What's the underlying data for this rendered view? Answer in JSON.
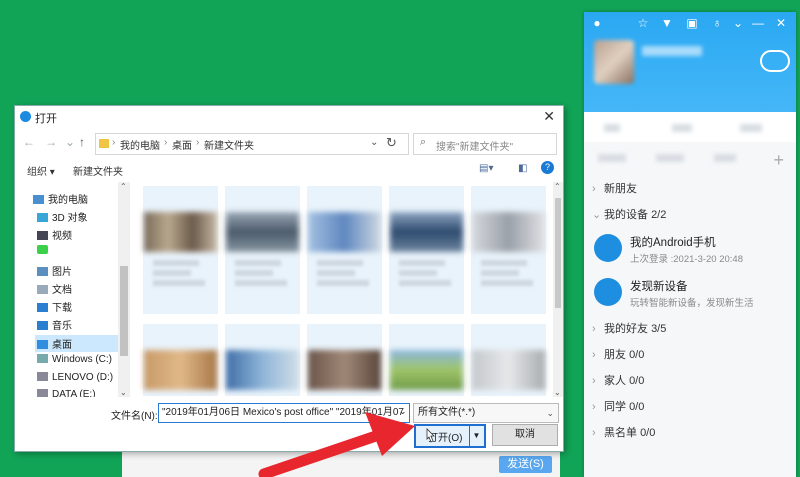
{
  "chat": {
    "send_label": "发送(S)"
  },
  "qq": {
    "groups": [
      {
        "label": "新朋友",
        "count": ""
      },
      {
        "label": "我的设备",
        "count": "2/2"
      },
      {
        "label": "我的好友",
        "count": "3/5"
      },
      {
        "label": "朋友",
        "count": "0/0"
      },
      {
        "label": "家人",
        "count": "0/0"
      },
      {
        "label": "同学",
        "count": "0/0"
      },
      {
        "label": "黑名单",
        "count": "0/0"
      }
    ],
    "devices": [
      {
        "title": "我的Android手机",
        "sub": "上次登录 :2021-3-20 20:48",
        "icon": "phone-icon"
      },
      {
        "title": "发现新设备",
        "sub": "玩转智能新设备，发现新生活",
        "icon": "radar-icon"
      }
    ],
    "plus_label": "+"
  },
  "dialog": {
    "title": "打开",
    "close": "✕",
    "nav": {
      "back": "←",
      "forward": "→",
      "dropdown": "⌄",
      "up": "↑",
      "refresh": "↻"
    },
    "breadcrumb": [
      "我的电脑",
      "桌面",
      "新建文件夹"
    ],
    "search_placeholder": "搜索\"新建文件夹\"",
    "toolbar": {
      "organize": "组织 ▾",
      "new_folder": "新建文件夹"
    },
    "sidebar": [
      {
        "label": "我的电脑",
        "icon": "computer-icon"
      },
      {
        "label": "3D 对象",
        "icon": "cube-icon"
      },
      {
        "label": "视频",
        "icon": "video-icon"
      },
      {
        "label": "",
        "icon": "app-icon"
      },
      {
        "label": "图片",
        "icon": "picture-icon"
      },
      {
        "label": "文档",
        "icon": "document-icon"
      },
      {
        "label": "下载",
        "icon": "download-icon"
      },
      {
        "label": "音乐",
        "icon": "music-icon"
      },
      {
        "label": "桌面",
        "icon": "desktop-icon",
        "selected": true
      },
      {
        "label": "Windows (C:)",
        "icon": "drive-icon"
      },
      {
        "label": "LENOVO (D:)",
        "icon": "drive-icon"
      },
      {
        "label": "DATA (E:)",
        "icon": "drive-icon"
      }
    ],
    "filename_label": "文件名(N):",
    "filename_value": "\"2019年01月06日 Mexico's post office\" \"2019年01月07",
    "filetype_value": "所有文件(*.*)",
    "open_label": "打开(O)",
    "cancel_label": "取消"
  }
}
